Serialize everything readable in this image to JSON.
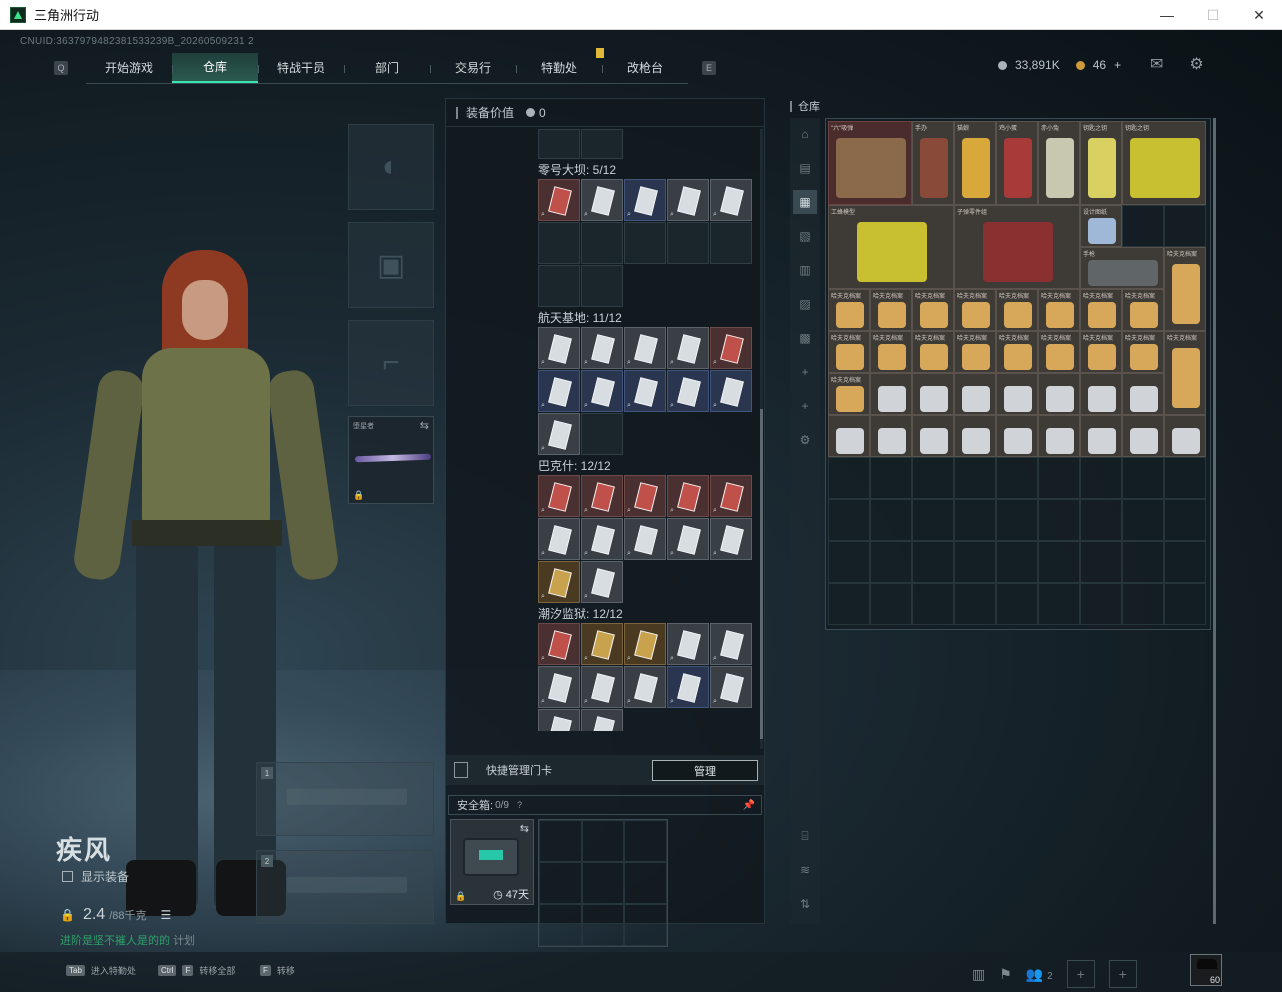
{
  "window": {
    "title": "三角洲行动",
    "minimize": "—",
    "maximize": "☐",
    "close": "✕"
  },
  "cnuid": "CNUID:3637979482381533239B_20260509231 2",
  "nav": {
    "left_key": "Q",
    "right_key": "E",
    "tabs": [
      "开始游戏",
      "仓库",
      "特战干员",
      "部门",
      "交易行",
      "特勤处",
      "改枪台"
    ],
    "active_tab": "仓库"
  },
  "currency": {
    "silver": "33,891K",
    "gold": "46",
    "gold_add": "+"
  },
  "icons": {
    "mail": "mail-icon",
    "settings": "gear-icon"
  },
  "operator": {
    "name": "疾风",
    "show_equipment": "显示装备",
    "weight_value": "2.4",
    "weight_max": "/88千克",
    "plan_green": "进阶是坚不摧人是的的",
    "plan_gray": "计划"
  },
  "equipment": {
    "melee_label": "堕星者",
    "gun_slot_1": "1",
    "gun_slot_2": "2"
  },
  "middle": {
    "title": "装备价值",
    "value": "0",
    "sections": [
      {
        "title": "零号大坝: 5/12"
      },
      {
        "title": "航天基地: 11/12"
      },
      {
        "title": "巴克什: 12/12"
      },
      {
        "title": "潮汐监狱: 12/12"
      }
    ],
    "quick_label": "快捷管理门卡",
    "manage_button": "管理",
    "safe_label": "安全箱:",
    "safe_count": "0/9",
    "safe_days": "47天"
  },
  "store": {
    "title": "仓库",
    "labels": [
      "\"六\"吸弹",
      "手办",
      "猫娘",
      "鸡小蛋",
      "赤小兔",
      "钥匙之钥",
      "钥匙之钥",
      "工蜂模型",
      "工蜂模型",
      "子弹零件组",
      "设计图纸",
      "手枪",
      "哈夫克档案"
    ]
  },
  "bottom": {
    "hint1_key": "Tab",
    "hint1": "进入特勤处",
    "hint2_key1": "Ctrl",
    "hint2_key2": "F",
    "hint2": "转移全部",
    "hint3_key": "F",
    "hint3": "转移",
    "team_count": "2",
    "avatar_level": "60"
  }
}
